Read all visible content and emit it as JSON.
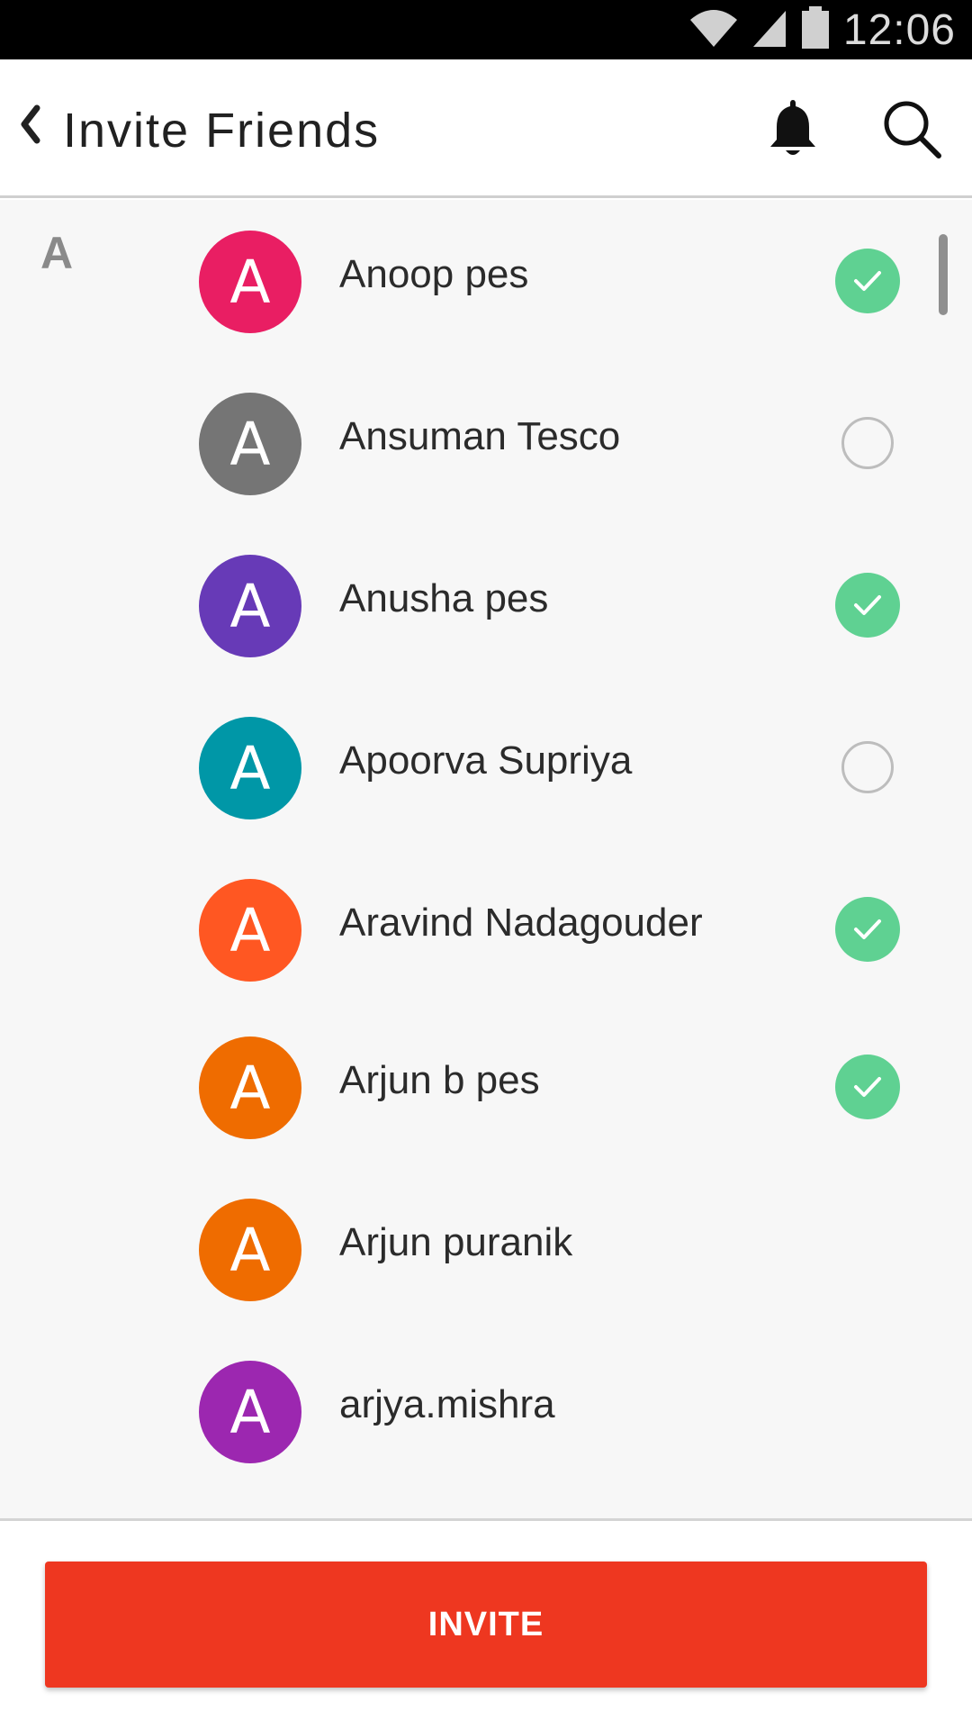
{
  "status_bar": {
    "time": "12:06",
    "wifi_icon": "wifi-icon",
    "signal_icon": "signal-icon",
    "battery_icon": "battery-icon"
  },
  "header": {
    "title": "Invite Friends",
    "back_icon": "chevron-left-icon",
    "notification_icon": "bell-icon",
    "search_icon": "search-icon"
  },
  "list": {
    "section_letter": "A",
    "contacts": [
      {
        "initial": "A",
        "name": "Anoop pes",
        "avatar_color": "#e91e63",
        "selection": "checked"
      },
      {
        "initial": "A",
        "name": "Ansuman Tesco",
        "avatar_color": "#757575",
        "selection": "unchecked"
      },
      {
        "initial": "A",
        "name": "Anusha pes",
        "avatar_color": "#673ab7",
        "selection": "checked"
      },
      {
        "initial": "A",
        "name": "Apoorva Supriya",
        "avatar_color": "#0097a7",
        "selection": "unchecked"
      },
      {
        "initial": "A",
        "name": "Aravind Nadagouder",
        "avatar_color": "#ff5722",
        "selection": "checked"
      },
      {
        "initial": "A",
        "name": "Arjun b pes",
        "avatar_color": "#ef6c00",
        "selection": "checked"
      },
      {
        "initial": "A",
        "name": "Arjun puranik",
        "avatar_color": "#ef6c00",
        "selection": "none"
      },
      {
        "initial": "A",
        "name": "arjya.mishra",
        "avatar_color": "#9c27b0",
        "selection": "none"
      }
    ]
  },
  "footer": {
    "invite_label": "INVITE"
  },
  "colors": {
    "accent": "#ee3720",
    "check_green": "#5fd192",
    "list_background": "#f7f7f7"
  }
}
